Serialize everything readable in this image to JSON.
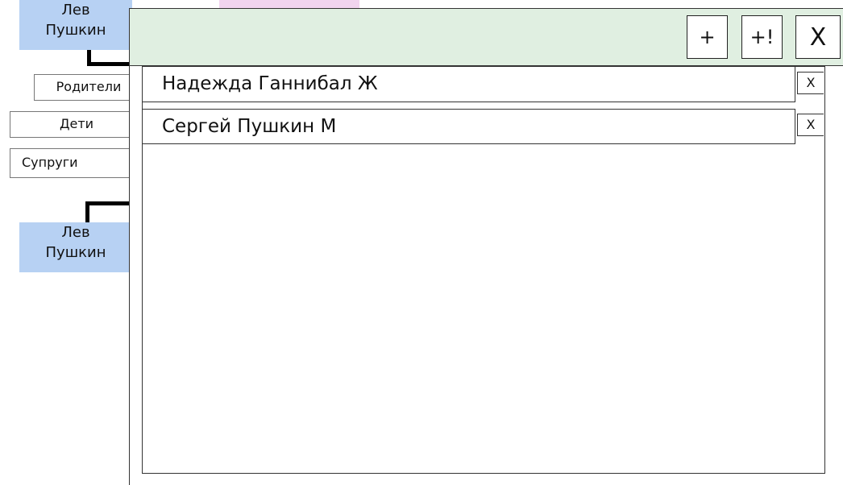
{
  "tree": {
    "top_person": [
      "Лев",
      "Пушкин"
    ],
    "bottom_person": [
      "Лев",
      "Пушкин"
    ],
    "buttons": {
      "parents": "Родители",
      "children": "Дети",
      "spouses": "Супруги"
    }
  },
  "dialog": {
    "add_label": "+",
    "add_main_label": "+!",
    "close_label": "X",
    "items": [
      {
        "name": "Надежда Ганнибал Ж",
        "remove_label": "X"
      },
      {
        "name": "Сергей Пушкин М",
        "remove_label": "X"
      }
    ]
  },
  "colors": {
    "person_node": "#b7d1f3",
    "dialog_header": "#e0efe1",
    "pink_node": "#f1d4ef"
  }
}
